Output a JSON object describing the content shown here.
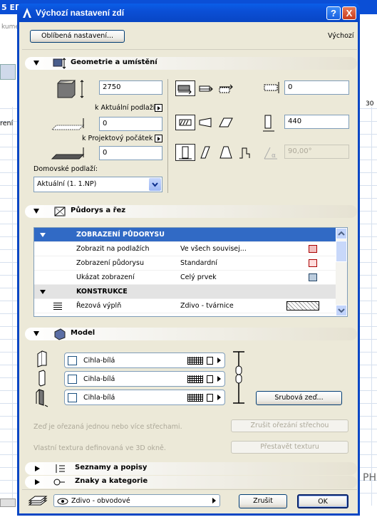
{
  "window": {
    "title": "Výchozí nastavení zdí",
    "help_btn": "?",
    "close_btn": "X"
  },
  "background": {
    "tab_text": "5 ED",
    "menu_text": "kume",
    "side_text": "rení",
    "ruler_value": "30",
    "right_text": "PH"
  },
  "top": {
    "favorites_label": "Oblíbená nastavení...",
    "default_label": "Výchozí"
  },
  "geometry": {
    "title": "Geometrie a umístění",
    "height": "2750",
    "top_offset": "0",
    "link1": "k Aktuální podlaží",
    "base_offset": "0",
    "link2": "k Projektový počátek",
    "home_label": "Domovské podlaží:",
    "home_value": "Aktuální (1. 1.NP)",
    "ref_offset": "0",
    "thickness": "440",
    "angle": "90,00°"
  },
  "floorplan": {
    "title": "Půdorys a řez",
    "rows": [
      {
        "type": "header",
        "c1": "ZOBRAZENÍ PŮDORYSU",
        "c2": "",
        "selected": true
      },
      {
        "type": "item",
        "c1": "Zobrazit na podlažích",
        "c2": "Ve všech souvisej..."
      },
      {
        "type": "item",
        "c1": "Zobrazení půdorysu",
        "c2": "Standardní"
      },
      {
        "type": "item",
        "c1": "Ukázat zobrazení",
        "c2": "Celý prvek"
      },
      {
        "type": "header",
        "c1": "KONSTRUKCE",
        "c2": "",
        "selected": false
      },
      {
        "type": "item",
        "c1": "Řezová výplň",
        "c2": "Zdivo - tvárnice"
      }
    ]
  },
  "model": {
    "title": "Model",
    "materials": [
      "Cihla-bílá",
      "Cihla-bílá",
      "Cihla-bílá"
    ],
    "log_btn": "Srubová zeď...",
    "roof_text": "Zeď je ořezaná jednou nebo více střechami.",
    "roof_btn": "Zrušit ořezání střechou",
    "texture_text": "Vlastní textura definovaná ve 3D okně.",
    "texture_btn": "Přestavět texturu"
  },
  "lists": {
    "title": "Seznamy a popisy"
  },
  "tags": {
    "title": "Znaky a kategorie"
  },
  "bottom": {
    "layer_value": "Zdivo - obvodové",
    "cancel": "Zrušit",
    "ok": "OK"
  },
  "colors": {
    "title_blue": "#0b4fd6",
    "dialog_bg": "#ece9d8",
    "selection": "#316ac5",
    "close_red": "#e04a2b"
  }
}
